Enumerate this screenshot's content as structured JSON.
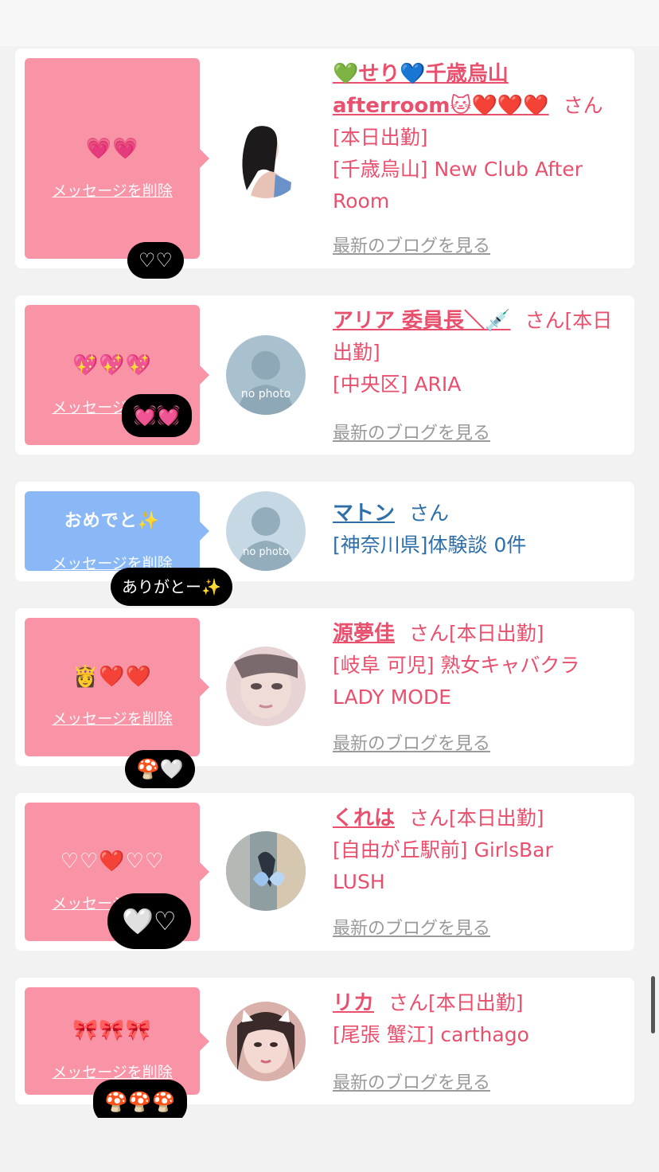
{
  "colors": {
    "pink": "#f994a6",
    "blue": "#8ab8f7",
    "name_pink": "#e8506e",
    "name_blue": "#2f6fa8"
  },
  "delete_label": "メッセージを削除",
  "blog_label": "最新のブログを見る",
  "cards": [
    {
      "message": "💗💗",
      "reply": "♡♡",
      "name_line1": "💚せり💙千歳烏山",
      "name_line2": "afterroom🐱❤️❤️❤️",
      "san": "さん",
      "status": "[本日出勤]",
      "shop_line1": "[千歳烏山] New Club After",
      "shop_line2": "Room",
      "avatar": "woman-photo"
    },
    {
      "message": "💖💖💖",
      "reply": "💓💓",
      "name": "アリア 委員長＼💉",
      "san_status": "さん[本日",
      "status_cont": "出勤]",
      "shop": "[中央区] ARIA",
      "avatar": "no-photo",
      "avatar_text": "no photo"
    },
    {
      "message": "おめでと✨",
      "reply": "ありがとー✨",
      "name": "マトン",
      "san": "さん",
      "shop": "[神奈川県]体験談 0件",
      "avatar": "no-photo-male",
      "avatar_text": "no photo"
    },
    {
      "message": "👸❤️❤️",
      "reply": "🍄🤍",
      "name": "源夢佳",
      "san_status": "さん[本日出勤]",
      "shop_line1": "[岐阜 可児] 熟女キャバクラ",
      "shop_line2": "LADY MODE",
      "avatar": "woman-photo"
    },
    {
      "message": "♡♡❤️♡♡",
      "reply": "🤍♡",
      "name": "くれは",
      "san_status": "さん[本日出勤]",
      "shop_line1": "[自由が丘駅前] GirlsBar",
      "shop_line2": "LUSH",
      "avatar": "butterfly-photo"
    },
    {
      "message": "🎀🎀🎀",
      "reply": "🍄🍄🍄",
      "name": "リカ",
      "san_status": "さん[本日出勤]",
      "shop": "[尾張 蟹江] carthago",
      "avatar": "woman-photo"
    }
  ]
}
